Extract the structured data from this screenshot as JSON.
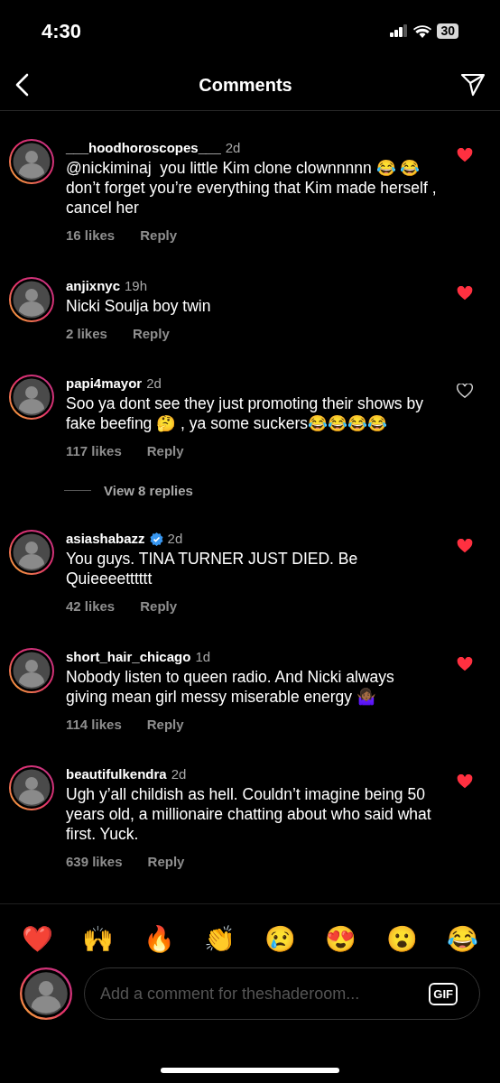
{
  "status_bar": {
    "time": "4:30",
    "battery": "30"
  },
  "header": {
    "title": "Comments"
  },
  "comments": [
    {
      "username": "___hoodhoroscopes___",
      "verified": false,
      "time": "2d",
      "text": "@nickiminaj  you little Kim clone clownnnnn 😂 😂 don’t forget you’re everything that Kim made herself , cancel her",
      "likes": "16 likes",
      "reply": "Reply",
      "liked": true
    },
    {
      "username": "anjixnyc",
      "verified": false,
      "time": "19h",
      "text": "Nicki Soulja boy twin",
      "likes": "2 likes",
      "reply": "Reply",
      "liked": true
    },
    {
      "username": "papi4mayor",
      "verified": false,
      "time": "2d",
      "text": "Soo ya dont see they just promoting their shows by fake beefing 🤔 , ya some suckers😂😂😂😂",
      "likes": "117 likes",
      "reply": "Reply",
      "liked": false,
      "view_replies": "View 8 replies"
    },
    {
      "username": "asiashabazz",
      "verified": true,
      "time": "2d",
      "text": "You guys. TINA TURNER JUST DIED. Be Quieeeetttttt",
      "likes": "42 likes",
      "reply": "Reply",
      "liked": true
    },
    {
      "username": "short_hair_chicago",
      "verified": false,
      "time": "1d",
      "text": "Nobody listen to queen radio. And Nicki always giving mean girl messy miserable energy 🤷🏾‍♀️",
      "likes": "114 likes",
      "reply": "Reply",
      "liked": true
    },
    {
      "username": "beautifulkendra",
      "verified": false,
      "time": "2d",
      "text": "Ugh y’all childish as hell. Couldn’t imagine being 50 years old, a millionaire chatting about who said what first. Yuck.",
      "likes": "639 likes",
      "reply": "Reply",
      "liked": true
    }
  ],
  "reactions": [
    "❤️",
    "🙌",
    "🔥",
    "👏",
    "😢",
    "😍",
    "😮",
    "😂"
  ],
  "composer": {
    "placeholder": "Add a comment for theshaderoom...",
    "gif": "GIF"
  }
}
